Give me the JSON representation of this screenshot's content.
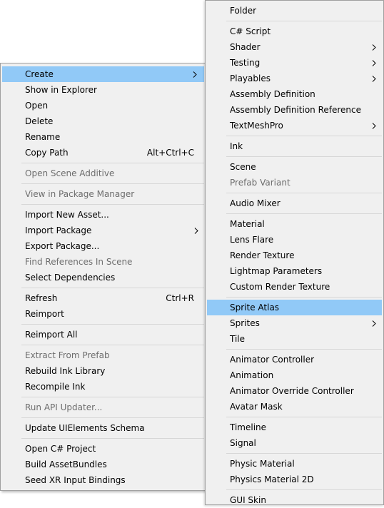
{
  "main_menu": {
    "create": "Create",
    "show_in_explorer": "Show in Explorer",
    "open": "Open",
    "delete": "Delete",
    "rename": "Rename",
    "copy_path": "Copy Path",
    "copy_path_shortcut": "Alt+Ctrl+C",
    "open_scene_additive": "Open Scene Additive",
    "view_in_package_manager": "View in Package Manager",
    "import_new_asset": "Import New Asset...",
    "import_package": "Import Package",
    "export_package": "Export Package...",
    "find_references_in_scene": "Find References In Scene",
    "select_dependencies": "Select Dependencies",
    "refresh": "Refresh",
    "refresh_shortcut": "Ctrl+R",
    "reimport": "Reimport",
    "reimport_all": "Reimport All",
    "extract_from_prefab": "Extract From Prefab",
    "rebuild_ink_library": "Rebuild Ink Library",
    "recompile_ink": "Recompile Ink",
    "run_api_updater": "Run API Updater...",
    "update_uielements_schema": "Update UIElements Schema",
    "open_csharp_project": "Open C# Project",
    "build_assetbundles": "Build AssetBundles",
    "seed_xr_input_bindings": "Seed XR Input Bindings"
  },
  "create_submenu": {
    "folder": "Folder",
    "csharp_script": "C# Script",
    "shader": "Shader",
    "testing": "Testing",
    "playables": "Playables",
    "assembly_definition": "Assembly Definition",
    "assembly_definition_reference": "Assembly Definition Reference",
    "textmeshpro": "TextMeshPro",
    "ink": "Ink",
    "scene": "Scene",
    "prefab_variant": "Prefab Variant",
    "audio_mixer": "Audio Mixer",
    "material": "Material",
    "lens_flare": "Lens Flare",
    "render_texture": "Render Texture",
    "lightmap_parameters": "Lightmap Parameters",
    "custom_render_texture": "Custom Render Texture",
    "sprite_atlas": "Sprite Atlas",
    "sprites": "Sprites",
    "tile": "Tile",
    "animator_controller": "Animator Controller",
    "animation": "Animation",
    "animator_override_controller": "Animator Override Controller",
    "avatar_mask": "Avatar Mask",
    "timeline": "Timeline",
    "signal": "Signal",
    "physic_material": "Physic Material",
    "physics_material_2d": "Physics Material 2D",
    "gui_skin": "GUI Skin"
  },
  "colors": {
    "menu_background": "#f0f0f0",
    "highlight": "#91c9f7",
    "disabled_text": "#6d6d6d",
    "separator": "#d7d7d7"
  },
  "icons": {
    "submenu_arrow": "chevron-right-icon"
  }
}
